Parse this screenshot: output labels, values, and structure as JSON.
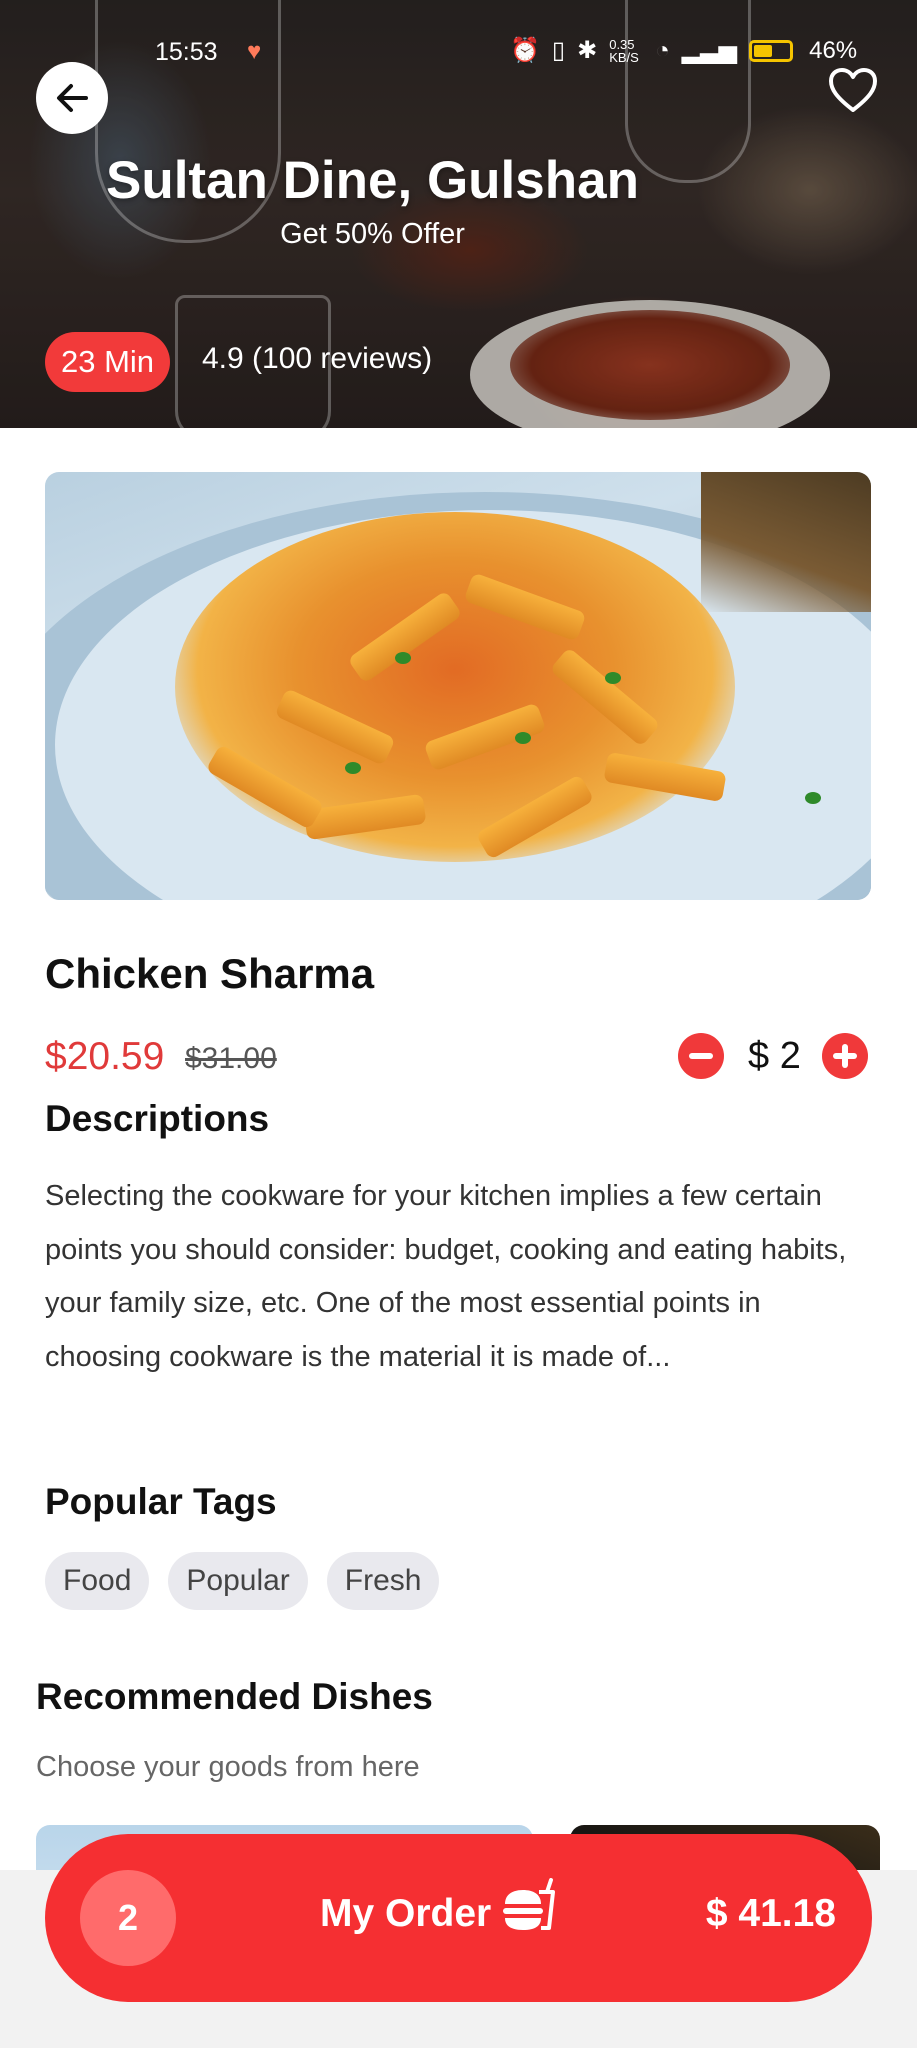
{
  "status_bar": {
    "time": "15:53",
    "network_speed": "0.35 KB/S",
    "battery": "46%"
  },
  "restaurant": {
    "name": "Sultan Dine, Gulshan",
    "offer": "Get 50% Offer",
    "delivery_time": "23 Min",
    "rating": "4.9 (100 reviews)"
  },
  "dish": {
    "name": "Chicken Sharma",
    "price": "$20.59",
    "old_price": "$31.00",
    "quantity": "$ 2"
  },
  "descriptions": {
    "title": "Descriptions",
    "text": "Selecting the cookware for your kitchen implies a few certain points you should consider: budget, cooking and eating habits, your family size, etc. One of the most essential points in choosing cookware is the material it is made of..."
  },
  "popular_tags": {
    "title": "Popular Tags",
    "tags": [
      "Food",
      "Popular",
      "Fresh"
    ]
  },
  "recommended": {
    "title": "Recommended Dishes",
    "subtitle": "Choose your goods from here"
  },
  "order_bar": {
    "count": "2",
    "label": "My Order",
    "total": "$ 41.18"
  },
  "colors": {
    "accent": "#f52f32",
    "price": "#e03a3a"
  },
  "icons": [
    "back-arrow-icon",
    "heart-icon",
    "minus-icon",
    "plus-icon",
    "burger-drink-icon"
  ]
}
